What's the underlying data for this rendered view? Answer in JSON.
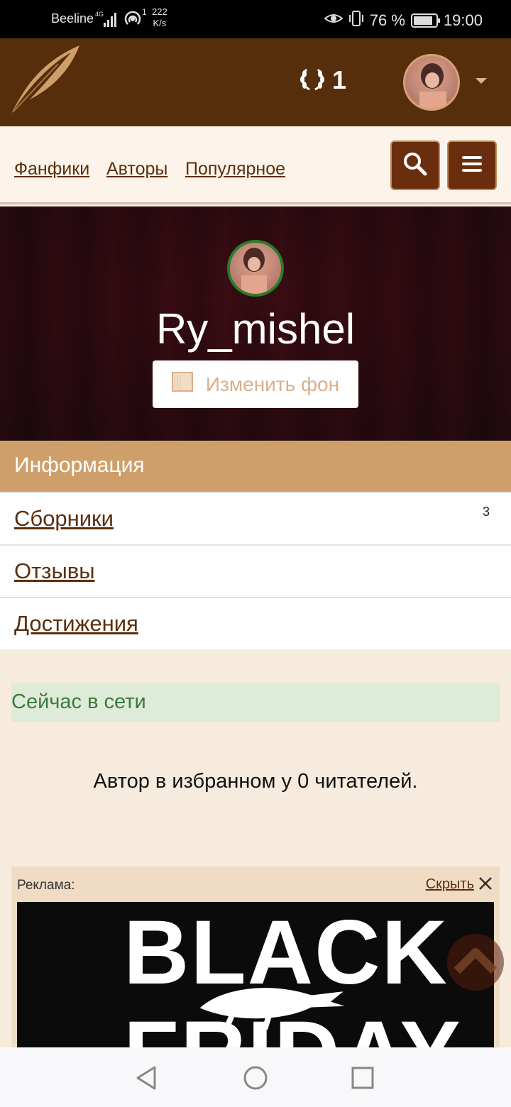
{
  "status_bar": {
    "carrier": "Beeline",
    "network": "4G",
    "speed_value": "222",
    "speed_unit": "K/s",
    "wifi_badge": "1",
    "battery": "76 %",
    "battery_level": 0.76,
    "time": "19:00"
  },
  "header": {
    "logo_icon": "feather-logo",
    "laurel_icon": "laurel-wreath-icon",
    "laurel_count": "1"
  },
  "nav": {
    "links": [
      "Фанфики",
      "Авторы",
      "Популярное"
    ],
    "search_icon": "search-icon",
    "menu_icon": "hamburger-menu-icon"
  },
  "profile": {
    "username": "Ry_mishel",
    "change_bg_label": "Изменить фон"
  },
  "info": {
    "header": "Информация",
    "rows": [
      {
        "label": "Сборники",
        "count": "3"
      },
      {
        "label": "Отзывы",
        "count": ""
      },
      {
        "label": "Достижения",
        "count": ""
      }
    ]
  },
  "online_status": "Сейчас в сети",
  "favorites_text": "Автор в избранном у 0 читателей.",
  "ad": {
    "label": "Реклама:",
    "hide_label": "Скрыть",
    "image_text_line1": "BLACK",
    "image_text_line2": "FRIDAY"
  },
  "colors": {
    "header_bg": "#562e0b",
    "accent": "#cf9f6b",
    "link": "#5b2f0d",
    "online_bg": "#ddebd8",
    "online_text": "#3d7a3d"
  }
}
